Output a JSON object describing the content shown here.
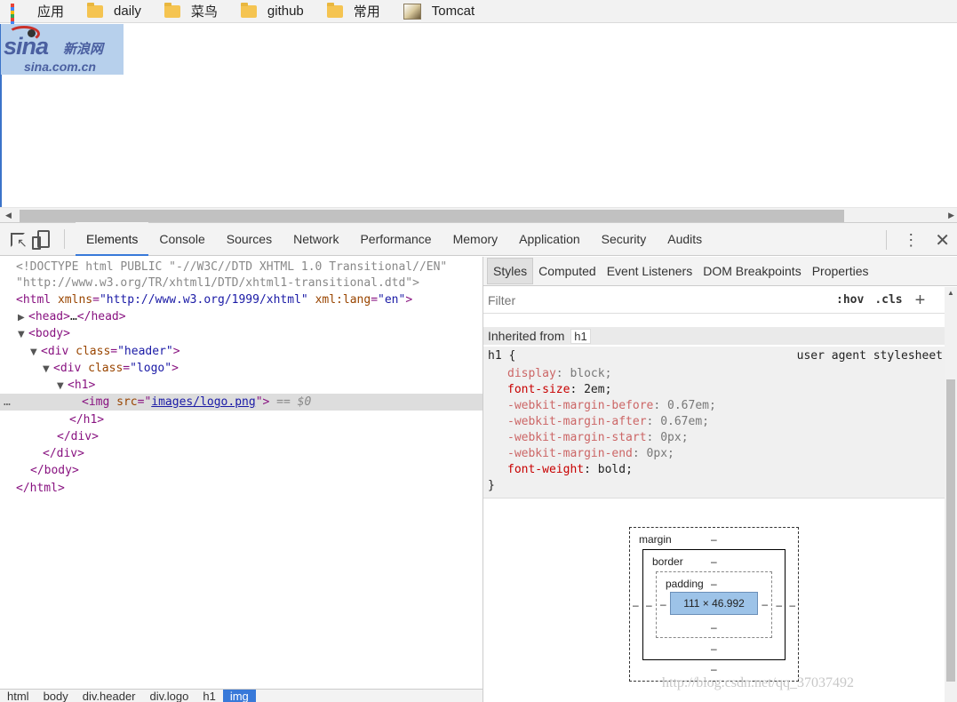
{
  "bookmarks": [
    {
      "label": "应用",
      "icon": "apps-icon"
    },
    {
      "label": "daily",
      "icon": "folder-icon"
    },
    {
      "label": "菜鸟",
      "icon": "folder-icon"
    },
    {
      "label": "github",
      "icon": "folder-icon"
    },
    {
      "label": "常用",
      "icon": "folder-icon"
    },
    {
      "label": "Tomcat",
      "icon": "tomcat-icon"
    }
  ],
  "page": {
    "logo_text": "sina",
    "logo_cn": "新浪网",
    "logo_domain": "sina.com.cn"
  },
  "devtools": {
    "tabs": [
      "Elements",
      "Console",
      "Sources",
      "Network",
      "Performance",
      "Memory",
      "Application",
      "Security",
      "Audits"
    ],
    "active_tab": "Elements",
    "elements": {
      "doctype_1": "<!DOCTYPE html PUBLIC \"-//W3C//DTD XHTML 1.0 Transitional//EN\"",
      "doctype_2": "\"http://www.w3.org/TR/xhtml1/DTD/xhtml1-transitional.dtd\">",
      "html_tag": "html",
      "html_attr1": "xmlns",
      "html_val1": "\"http://www.w3.org/1999/xhtml\"",
      "html_attr2": "xml:lang",
      "html_val2": "\"en\"",
      "head_collapsed": "…",
      "div_header_class": "\"header\"",
      "div_logo_class": "\"logo\"",
      "img_src": "images/logo.png",
      "selected_suffix": "== $0"
    },
    "breadcrumb": [
      "html",
      "body",
      "div.header",
      "div.logo",
      "h1",
      "img"
    ],
    "styles_tabs": [
      "Styles",
      "Computed",
      "Event Listeners",
      "DOM Breakpoints",
      "Properties"
    ],
    "filter_placeholder": "Filter",
    "filter_hov": ":hov",
    "filter_cls": ".cls",
    "inherited_from_label": "Inherited from",
    "inherited_from_tag": "h1",
    "rule": {
      "selector": "h1 {",
      "origin": "user agent stylesheet",
      "props": [
        {
          "name": "display",
          "value": "block",
          "active": false
        },
        {
          "name": "font-size",
          "value": "2em",
          "active": true
        },
        {
          "name": "-webkit-margin-before",
          "value": "0.67em",
          "active": false
        },
        {
          "name": "-webkit-margin-after",
          "value": "0.67em",
          "active": false
        },
        {
          "name": "-webkit-margin-start",
          "value": "0px",
          "active": false
        },
        {
          "name": "-webkit-margin-end",
          "value": "0px",
          "active": false
        },
        {
          "name": "font-weight",
          "value": "bold",
          "active": true
        }
      ],
      "close": "}"
    },
    "box_model": {
      "margin_label": "margin",
      "border_label": "border",
      "padding_label": "padding",
      "dash": "–",
      "content_size": "111 × 46.992"
    }
  },
  "watermark": "http://blog.csdn.net/qq_37037492"
}
